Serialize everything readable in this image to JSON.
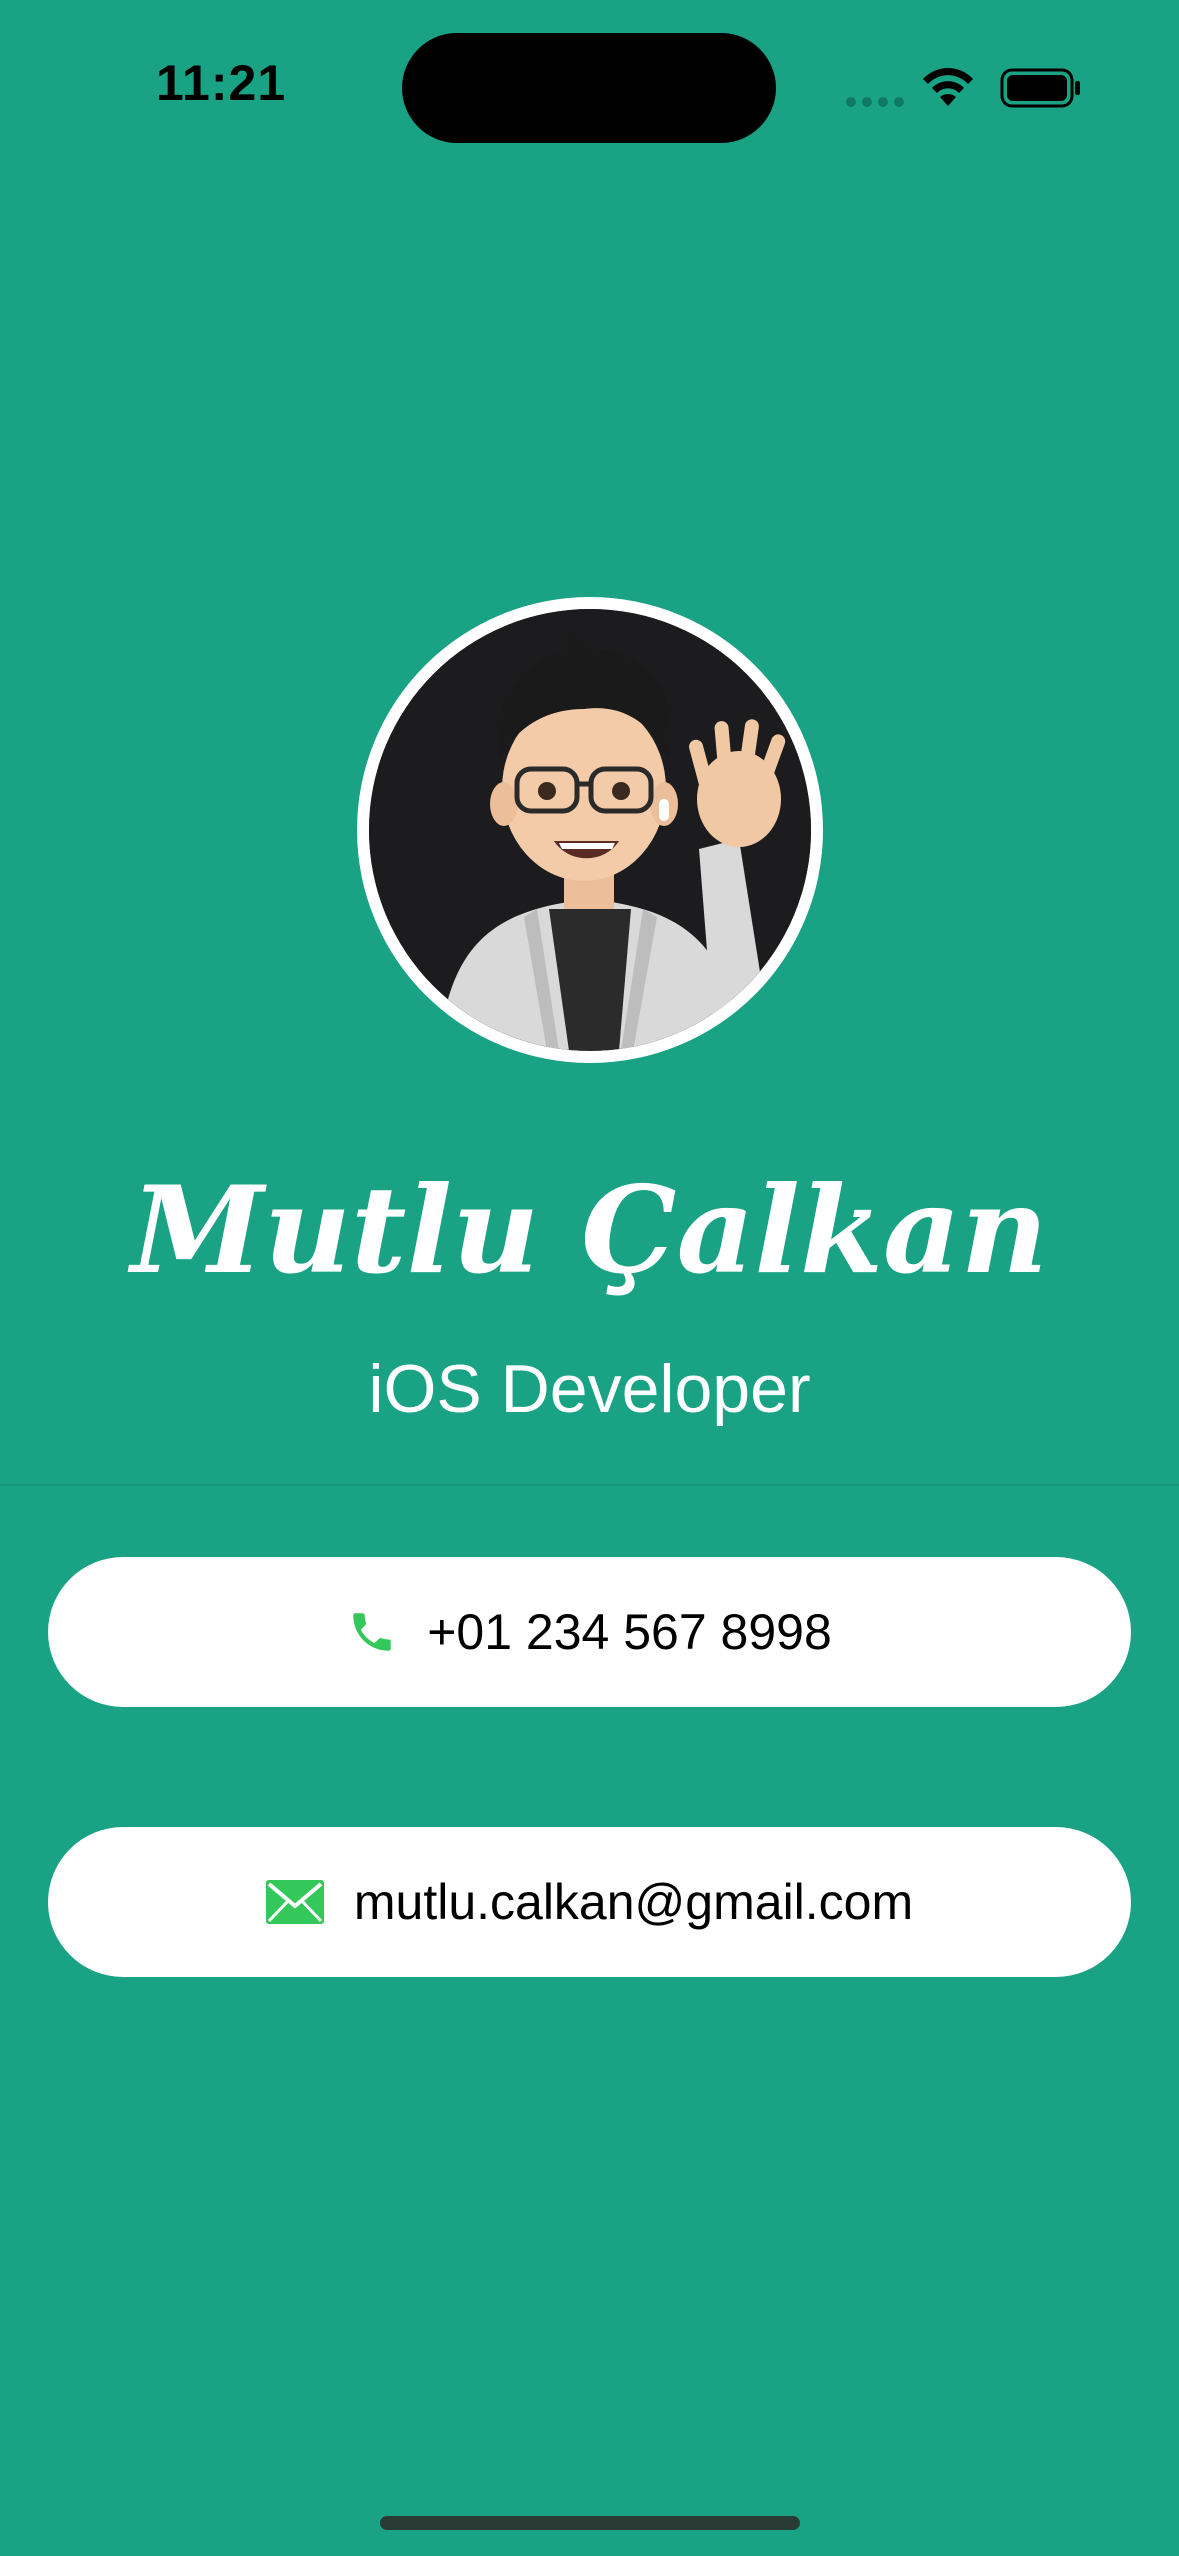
{
  "status_bar": {
    "time": "11:21",
    "icons": [
      "cellular-signal-icon",
      "wifi-icon",
      "battery-icon"
    ]
  },
  "profile": {
    "avatar": "memoji-avatar",
    "name": "Mutlu Çalkan",
    "role": "iOS Developer"
  },
  "contacts": {
    "phone": {
      "icon": "phone-icon",
      "value": "+01 234 567 8998"
    },
    "email": {
      "icon": "envelope-icon",
      "value": "mutlu.calkan@gmail.com"
    }
  },
  "colors": {
    "background": "#1aa284",
    "card": "#ffffff",
    "icon_green": "#34c759"
  }
}
